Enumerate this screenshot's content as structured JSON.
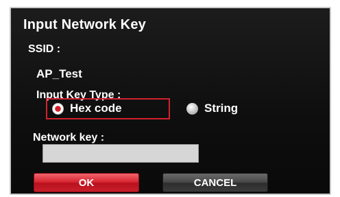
{
  "dialog": {
    "title": "Input Network Key",
    "ssid_label": "SSID :",
    "ssid_value": "AP_Test",
    "key_type_label": "Input Key Type :",
    "key_types": [
      {
        "label": "Hex code",
        "selected": true
      },
      {
        "label": "String",
        "selected": false
      }
    ],
    "network_key_label": "Network key :",
    "network_key_value": "",
    "ok_label": "OK",
    "cancel_label": "CANCEL"
  },
  "colors": {
    "accent": "#d41e2a",
    "dialog_bg": "#121212",
    "input_bg": "#d6d6d6"
  }
}
